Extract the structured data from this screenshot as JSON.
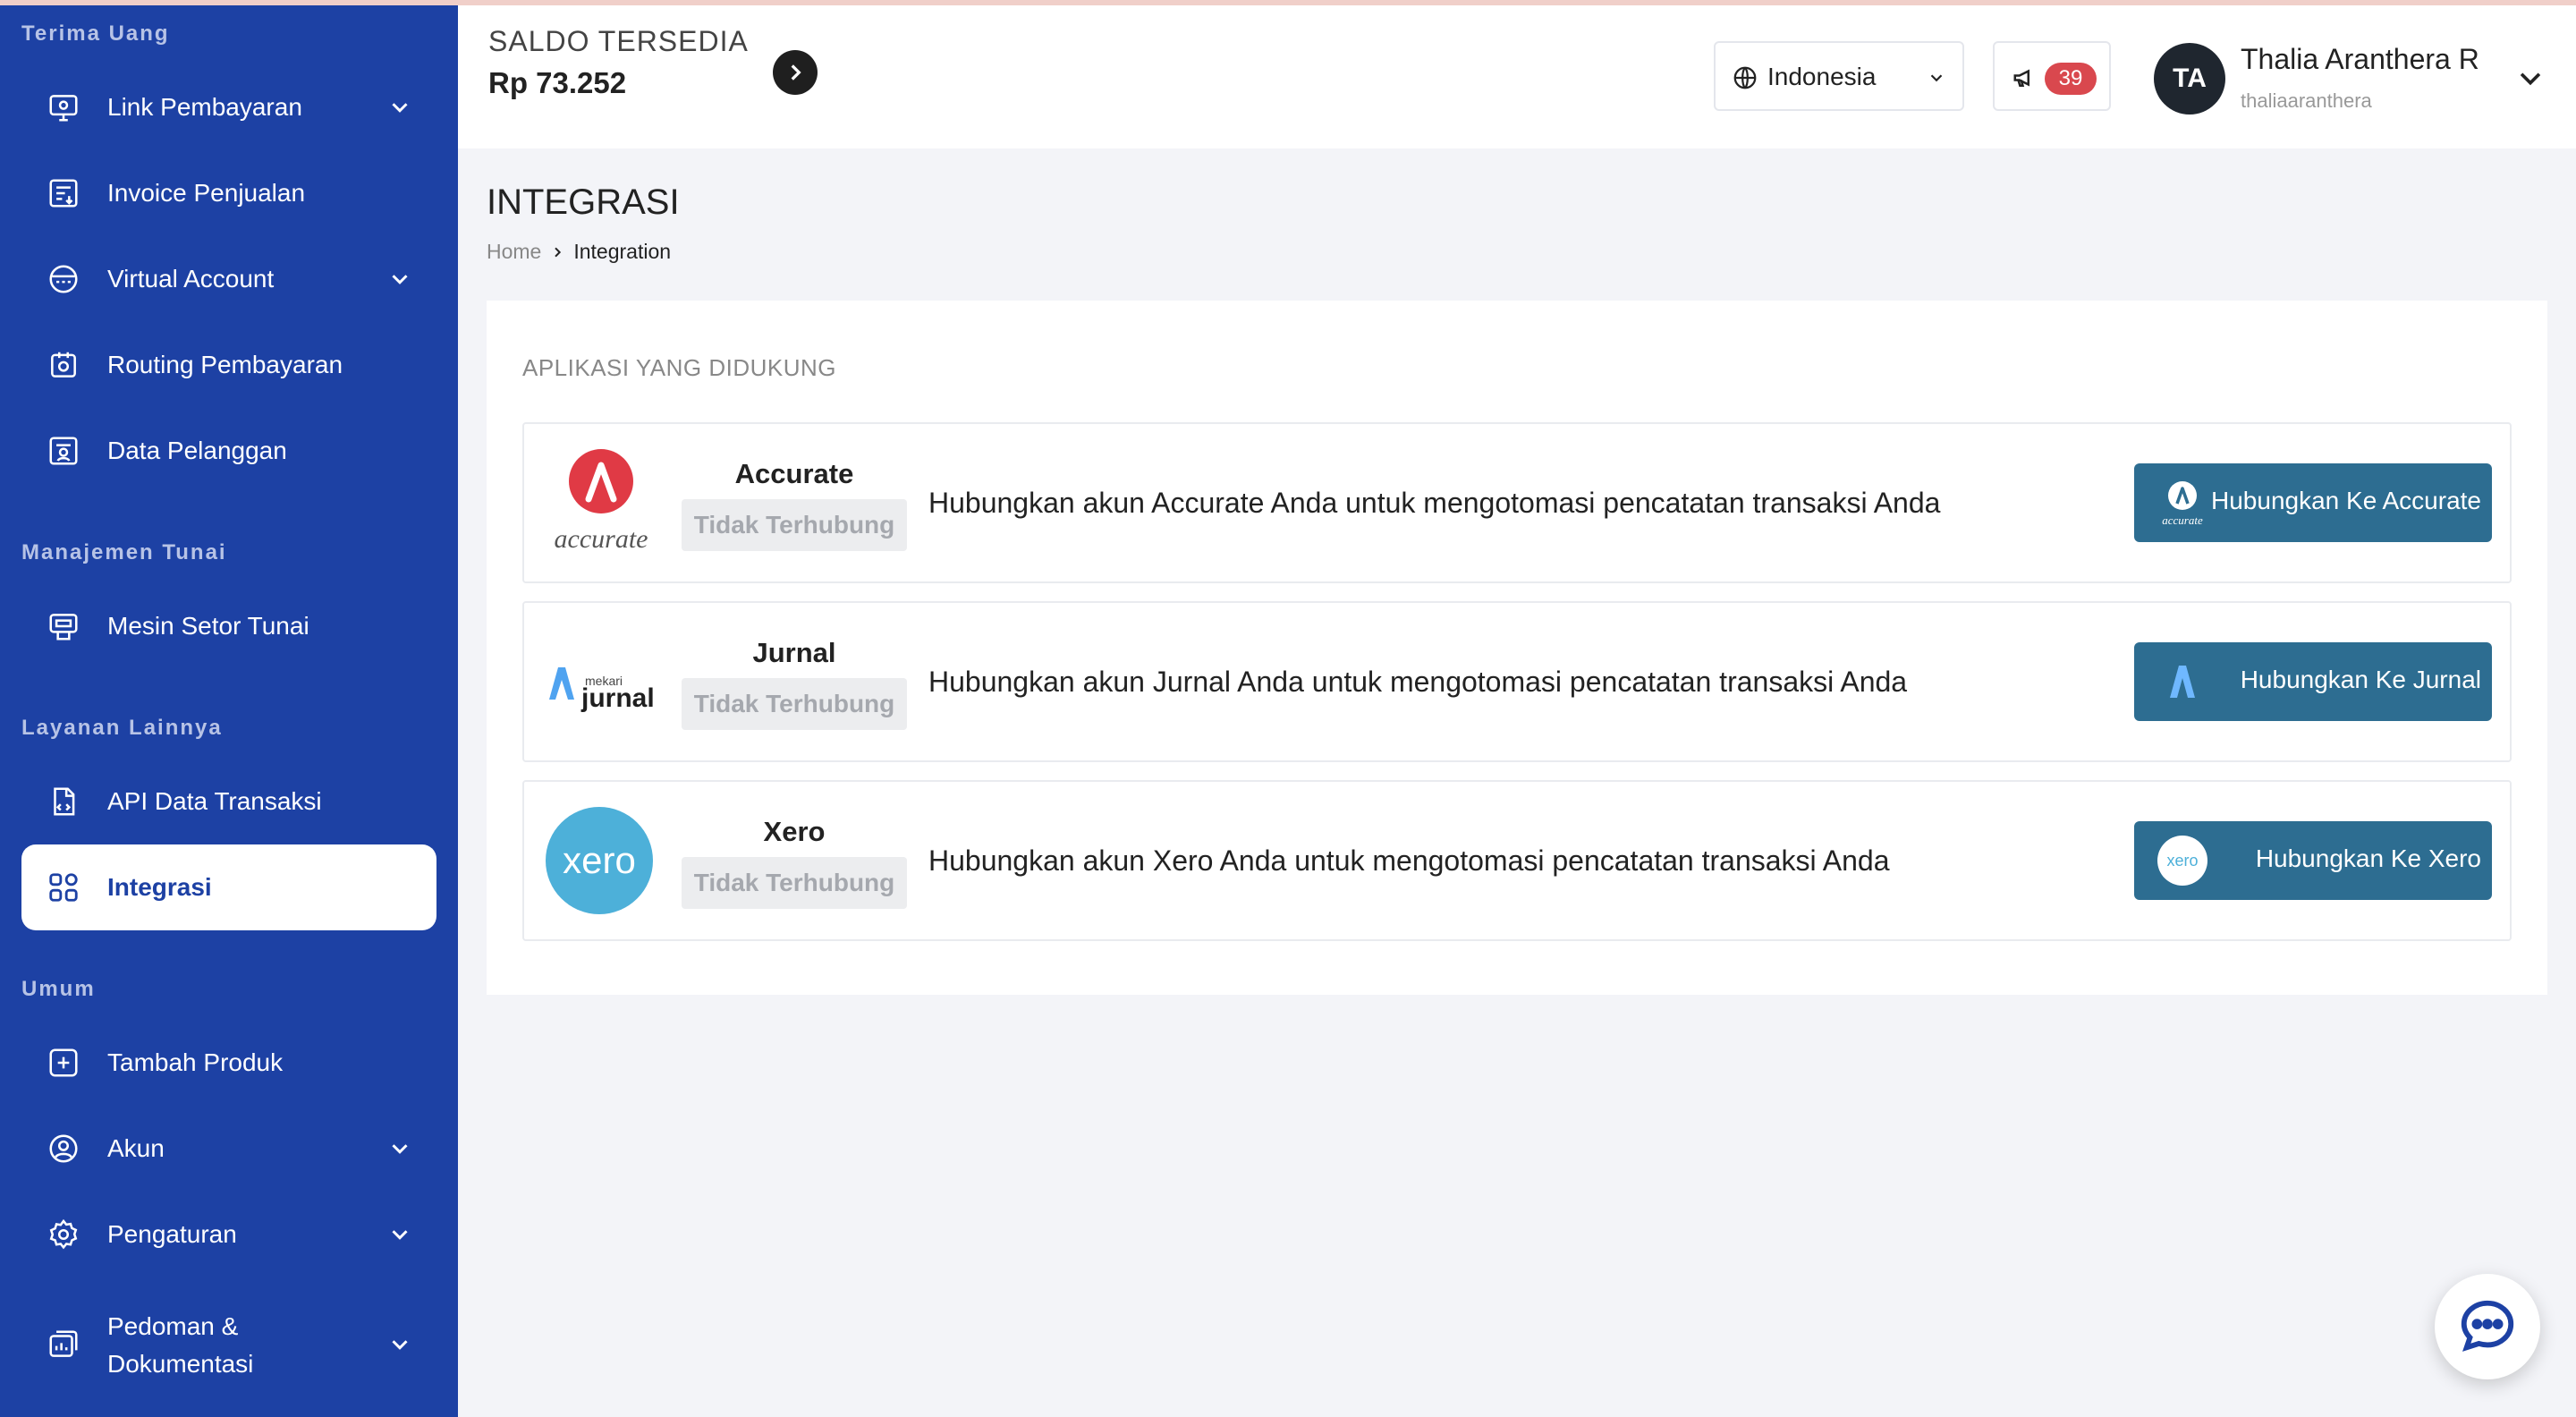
{
  "sidebar": {
    "sections": [
      {
        "title": "Terima Uang"
      },
      {
        "title": "Manajemen Tunai"
      },
      {
        "title": "Layanan Lainnya"
      },
      {
        "title": "Umum"
      }
    ],
    "items": [
      {
        "label": "Link Pembayaran",
        "icon": "link-payment-icon",
        "expandable": true
      },
      {
        "label": "Invoice Penjualan",
        "icon": "invoice-icon",
        "expandable": false
      },
      {
        "label": "Virtual Account",
        "icon": "virtual-account-icon",
        "expandable": true
      },
      {
        "label": "Routing Pembayaran",
        "icon": "routing-icon",
        "expandable": false
      },
      {
        "label": "Data Pelanggan",
        "icon": "customer-data-icon",
        "expandable": false
      },
      {
        "label": "Mesin Setor Tunai",
        "icon": "cash-machine-icon",
        "expandable": false
      },
      {
        "label": "API Data Transaksi",
        "icon": "api-icon",
        "expandable": false
      },
      {
        "label": "Integrasi",
        "icon": "integration-icon",
        "expandable": false,
        "active": true
      },
      {
        "label": "Tambah Produk",
        "icon": "add-product-icon",
        "expandable": false
      },
      {
        "label": "Akun",
        "icon": "account-icon",
        "expandable": true
      },
      {
        "label": "Pengaturan",
        "icon": "settings-icon",
        "expandable": true
      },
      {
        "label_line1": "Pedoman &",
        "label_line2": "Dokumentasi",
        "icon": "docs-icon",
        "expandable": true
      }
    ]
  },
  "header": {
    "saldo_title": "SALDO TERSEDIA",
    "saldo_value": "Rp 73.252",
    "language": "Indonesia",
    "notification_count": "39",
    "user_initials": "TA",
    "user_name": "Thalia Aranthera R",
    "user_handle": "thaliaaranthera"
  },
  "page": {
    "title": "INTEGRASI",
    "breadcrumb": {
      "home": "Home",
      "current": "Integration"
    }
  },
  "panel": {
    "title": "APLIKASI YANG DIDUKUNG",
    "apps": [
      {
        "name": "Accurate",
        "logo_text": "accurate",
        "status": "Tidak Terhubung",
        "description": "Hubungkan akun Accurate Anda untuk mengotomasi pencatatan transaksi Anda",
        "button": "Hubungkan Ke Accurate",
        "button_logo_text": "accurate"
      },
      {
        "name": "Jurnal",
        "logo_text_small": "mekari",
        "logo_text": "jurnal",
        "status": "Tidak Terhubung",
        "description": "Hubungkan akun Jurnal Anda untuk mengotomasi pencatatan transaksi Anda",
        "button": "Hubungkan Ke Jurnal"
      },
      {
        "name": "Xero",
        "logo_text": "xero",
        "status": "Tidak Terhubung",
        "description": "Hubungkan akun Xero Anda untuk mengotomasi pencatatan transaksi Anda",
        "button": "Hubungkan Ke Xero",
        "button_logo_text": "xero"
      }
    ]
  },
  "colors": {
    "sidebar_bg": "#1d41a4",
    "button_bg": "#2d6d91",
    "badge": "#d9484e",
    "accurate_red": "#e03a45",
    "xero_blue": "#4db0d9"
  }
}
